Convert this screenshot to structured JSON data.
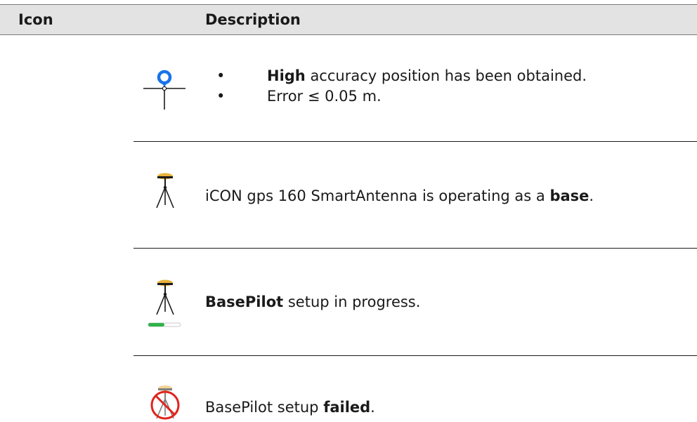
{
  "table": {
    "headers": {
      "icon": "Icon",
      "description": "Description"
    },
    "rows": [
      {
        "icon": "high-accuracy-position-icon",
        "bullets": [
          {
            "bold": "High",
            "text": " accuracy position has been obtained."
          },
          {
            "bold": "",
            "text": "Error ≤ 0.05 m."
          }
        ],
        "bullet_glyph": "•"
      },
      {
        "icon": "base-tripod-icon",
        "pre": "iCON gps 160 SmartAntenna is operating as a ",
        "bold": "base",
        "post": "."
      },
      {
        "icon": "basepilot-progress-icon",
        "bold": "BasePilot",
        "post": " setup in progress.",
        "progress": 0.5
      },
      {
        "icon": "basepilot-failed-icon",
        "pre": "BasePilot setup ",
        "bold": "failed",
        "post": "."
      }
    ]
  },
  "colors": {
    "header_bg": "#e3e3e3",
    "pin_blue": "#1a73e8",
    "antenna_gold": "#e8b23a",
    "progress_green": "#2fb34a",
    "fail_red": "#e0241b"
  }
}
